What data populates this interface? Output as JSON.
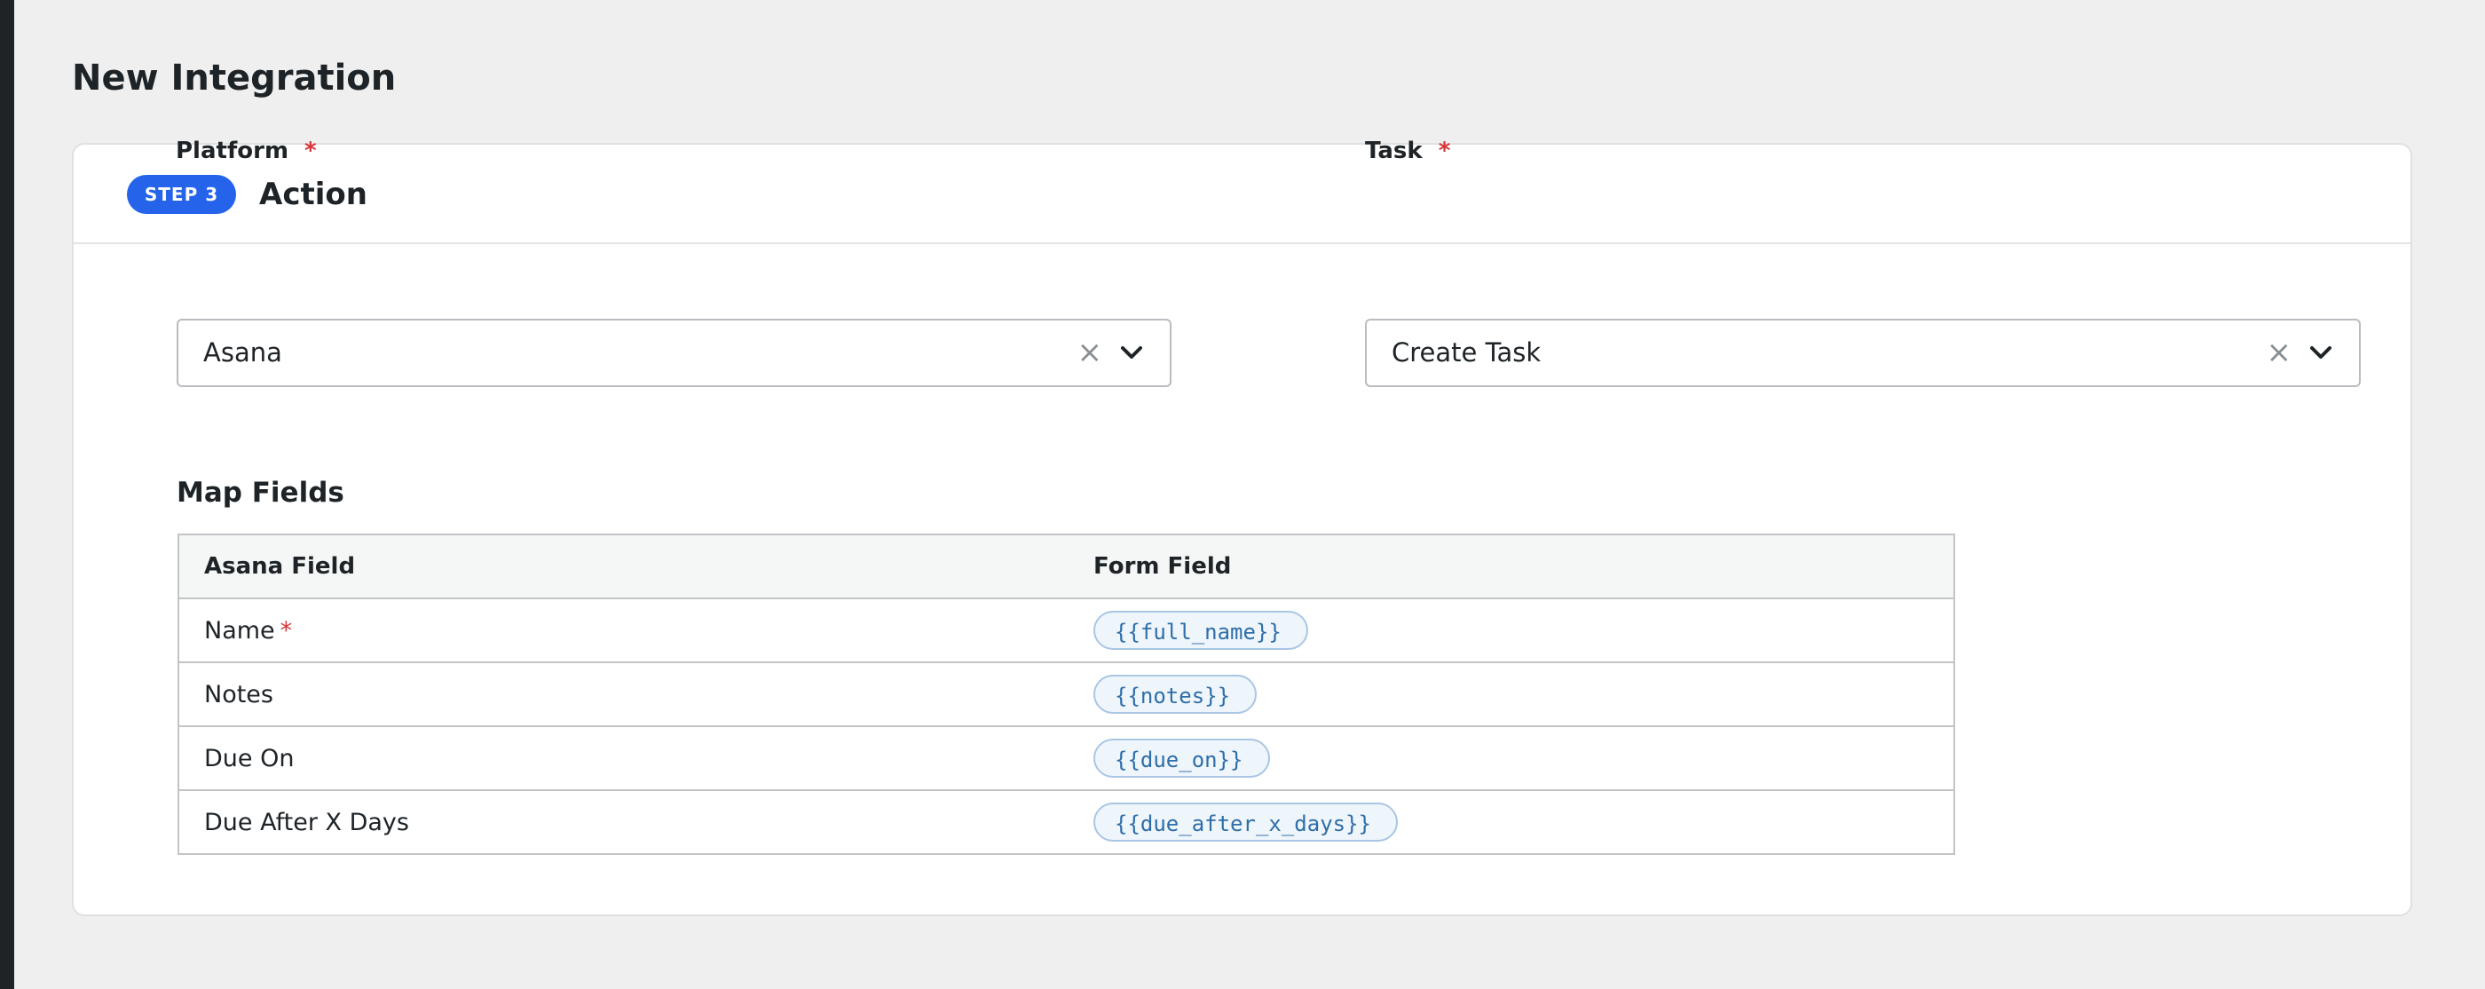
{
  "page": {
    "title": "New Integration"
  },
  "step": {
    "badge": "STEP 3",
    "title": "Action"
  },
  "platform": {
    "label": "Platform",
    "required_mark": "*",
    "value": "Asana",
    "clear_glyph": "×"
  },
  "task": {
    "label": "Task",
    "required_mark": "*",
    "value": "Create Task",
    "clear_glyph": "×"
  },
  "map_fields": {
    "title": "Map Fields",
    "columns": [
      "Asana Field",
      "Form Field"
    ],
    "rows": [
      {
        "field": "Name",
        "required_mark": "*",
        "token": "{{full_name}}"
      },
      {
        "field": "Notes",
        "required_mark": "",
        "token": "{{notes}}"
      },
      {
        "field": "Due On",
        "required_mark": "",
        "token": "{{due_on}}"
      },
      {
        "field": "Due After X Days",
        "required_mark": "",
        "token": "{{due_after_x_days}}"
      }
    ]
  },
  "icons": {
    "clear": "close-icon",
    "dropdown": "chevron-down-icon"
  },
  "colors": {
    "badge": "#2563eb",
    "required": "#d63638",
    "token_text": "#2f6ea8",
    "token_bg": "#eef5fb",
    "token_border": "#a9c6e3"
  }
}
